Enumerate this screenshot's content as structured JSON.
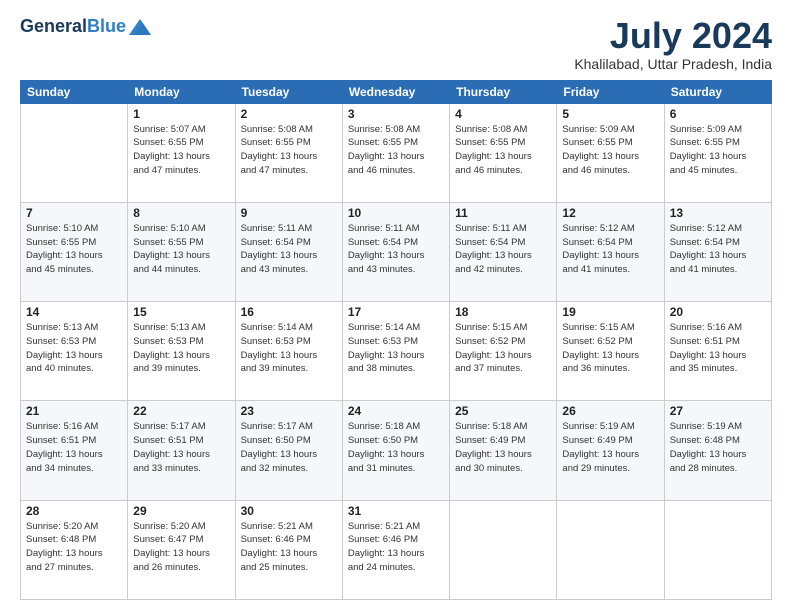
{
  "header": {
    "logo": {
      "general": "General",
      "blue": "Blue"
    },
    "title": "July 2024",
    "location": "Khalilabad, Uttar Pradesh, India"
  },
  "weekdays": [
    "Sunday",
    "Monday",
    "Tuesday",
    "Wednesday",
    "Thursday",
    "Friday",
    "Saturday"
  ],
  "weeks": [
    [
      {
        "day": "",
        "info": ""
      },
      {
        "day": "1",
        "info": "Sunrise: 5:07 AM\nSunset: 6:55 PM\nDaylight: 13 hours\nand 47 minutes."
      },
      {
        "day": "2",
        "info": "Sunrise: 5:08 AM\nSunset: 6:55 PM\nDaylight: 13 hours\nand 47 minutes."
      },
      {
        "day": "3",
        "info": "Sunrise: 5:08 AM\nSunset: 6:55 PM\nDaylight: 13 hours\nand 46 minutes."
      },
      {
        "day": "4",
        "info": "Sunrise: 5:08 AM\nSunset: 6:55 PM\nDaylight: 13 hours\nand 46 minutes."
      },
      {
        "day": "5",
        "info": "Sunrise: 5:09 AM\nSunset: 6:55 PM\nDaylight: 13 hours\nand 46 minutes."
      },
      {
        "day": "6",
        "info": "Sunrise: 5:09 AM\nSunset: 6:55 PM\nDaylight: 13 hours\nand 45 minutes."
      }
    ],
    [
      {
        "day": "7",
        "info": "Sunrise: 5:10 AM\nSunset: 6:55 PM\nDaylight: 13 hours\nand 45 minutes."
      },
      {
        "day": "8",
        "info": "Sunrise: 5:10 AM\nSunset: 6:55 PM\nDaylight: 13 hours\nand 44 minutes."
      },
      {
        "day": "9",
        "info": "Sunrise: 5:11 AM\nSunset: 6:54 PM\nDaylight: 13 hours\nand 43 minutes."
      },
      {
        "day": "10",
        "info": "Sunrise: 5:11 AM\nSunset: 6:54 PM\nDaylight: 13 hours\nand 43 minutes."
      },
      {
        "day": "11",
        "info": "Sunrise: 5:11 AM\nSunset: 6:54 PM\nDaylight: 13 hours\nand 42 minutes."
      },
      {
        "day": "12",
        "info": "Sunrise: 5:12 AM\nSunset: 6:54 PM\nDaylight: 13 hours\nand 41 minutes."
      },
      {
        "day": "13",
        "info": "Sunrise: 5:12 AM\nSunset: 6:54 PM\nDaylight: 13 hours\nand 41 minutes."
      }
    ],
    [
      {
        "day": "14",
        "info": "Sunrise: 5:13 AM\nSunset: 6:53 PM\nDaylight: 13 hours\nand 40 minutes."
      },
      {
        "day": "15",
        "info": "Sunrise: 5:13 AM\nSunset: 6:53 PM\nDaylight: 13 hours\nand 39 minutes."
      },
      {
        "day": "16",
        "info": "Sunrise: 5:14 AM\nSunset: 6:53 PM\nDaylight: 13 hours\nand 39 minutes."
      },
      {
        "day": "17",
        "info": "Sunrise: 5:14 AM\nSunset: 6:53 PM\nDaylight: 13 hours\nand 38 minutes."
      },
      {
        "day": "18",
        "info": "Sunrise: 5:15 AM\nSunset: 6:52 PM\nDaylight: 13 hours\nand 37 minutes."
      },
      {
        "day": "19",
        "info": "Sunrise: 5:15 AM\nSunset: 6:52 PM\nDaylight: 13 hours\nand 36 minutes."
      },
      {
        "day": "20",
        "info": "Sunrise: 5:16 AM\nSunset: 6:51 PM\nDaylight: 13 hours\nand 35 minutes."
      }
    ],
    [
      {
        "day": "21",
        "info": "Sunrise: 5:16 AM\nSunset: 6:51 PM\nDaylight: 13 hours\nand 34 minutes."
      },
      {
        "day": "22",
        "info": "Sunrise: 5:17 AM\nSunset: 6:51 PM\nDaylight: 13 hours\nand 33 minutes."
      },
      {
        "day": "23",
        "info": "Sunrise: 5:17 AM\nSunset: 6:50 PM\nDaylight: 13 hours\nand 32 minutes."
      },
      {
        "day": "24",
        "info": "Sunrise: 5:18 AM\nSunset: 6:50 PM\nDaylight: 13 hours\nand 31 minutes."
      },
      {
        "day": "25",
        "info": "Sunrise: 5:18 AM\nSunset: 6:49 PM\nDaylight: 13 hours\nand 30 minutes."
      },
      {
        "day": "26",
        "info": "Sunrise: 5:19 AM\nSunset: 6:49 PM\nDaylight: 13 hours\nand 29 minutes."
      },
      {
        "day": "27",
        "info": "Sunrise: 5:19 AM\nSunset: 6:48 PM\nDaylight: 13 hours\nand 28 minutes."
      }
    ],
    [
      {
        "day": "28",
        "info": "Sunrise: 5:20 AM\nSunset: 6:48 PM\nDaylight: 13 hours\nand 27 minutes."
      },
      {
        "day": "29",
        "info": "Sunrise: 5:20 AM\nSunset: 6:47 PM\nDaylight: 13 hours\nand 26 minutes."
      },
      {
        "day": "30",
        "info": "Sunrise: 5:21 AM\nSunset: 6:46 PM\nDaylight: 13 hours\nand 25 minutes."
      },
      {
        "day": "31",
        "info": "Sunrise: 5:21 AM\nSunset: 6:46 PM\nDaylight: 13 hours\nand 24 minutes."
      },
      {
        "day": "",
        "info": ""
      },
      {
        "day": "",
        "info": ""
      },
      {
        "day": "",
        "info": ""
      }
    ]
  ]
}
